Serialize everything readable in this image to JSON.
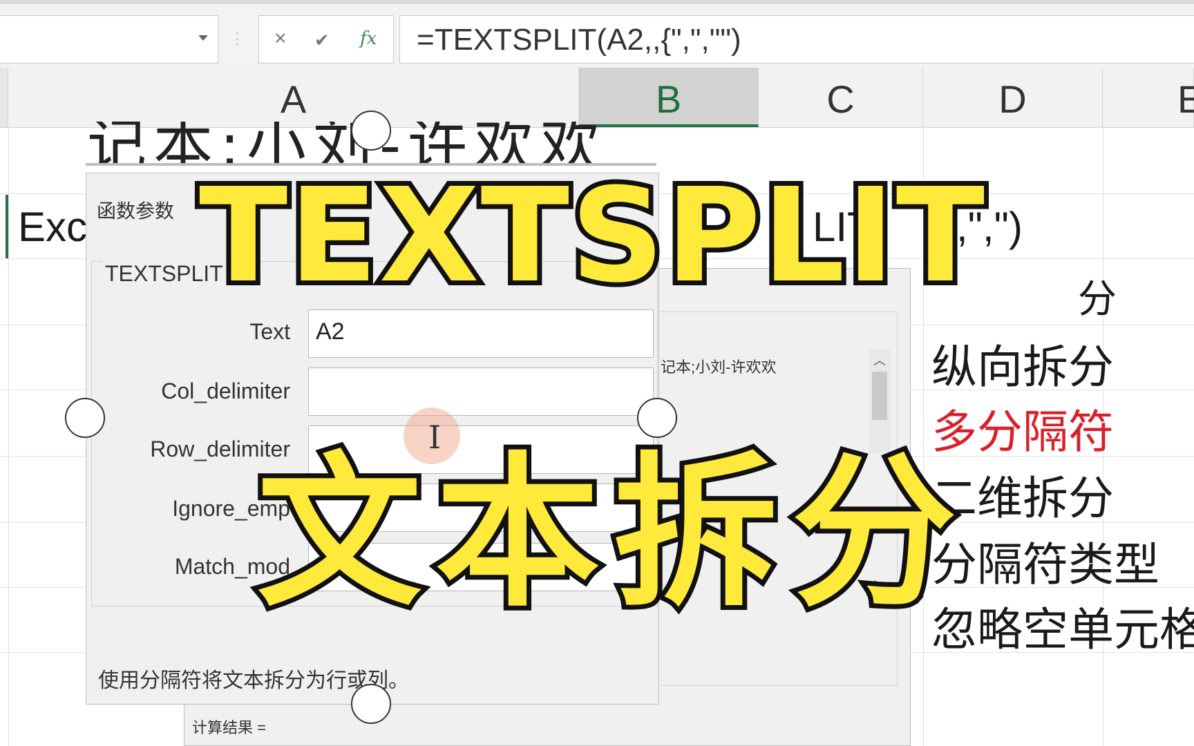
{
  "formula_bar": {
    "cancel_icon": "close-icon",
    "enter_icon": "check-icon",
    "fx_icon": "fx-icon",
    "fx_label": "fx",
    "cancel_glyph": "×",
    "enter_glyph": "✔",
    "formula": "=TEXTSPLIT(A2,,{\",\",\"\")"
  },
  "columns": [
    "A",
    "B",
    "C",
    "D",
    "E"
  ],
  "selected_column": "B",
  "cells": {
    "a2_partial": "Exc",
    "c2_partial": "LIT(",
    "e2_partial": ",\",\")",
    "d_list": [
      "纵向拆分",
      "多分隔符",
      "二维拆分",
      "分隔符类型",
      "忽略空单元格"
    ],
    "d_top_partial": "分",
    "a1_partial": "记本;小刘-许欢欢"
  },
  "dialog": {
    "title": "函数参数",
    "function_name": "TEXTSPLIT",
    "args": [
      {
        "label": "Text",
        "value": "A2"
      },
      {
        "label": "Col_delimiter",
        "value": ""
      },
      {
        "label": "Row_delimiter",
        "value": ""
      },
      {
        "label": "Ignore_emp",
        "value": ""
      },
      {
        "label": "Match_mod",
        "value": ""
      }
    ],
    "preview": "笔记本;小刘-许欢欢\"",
    "description": "使用分隔符将文本拆分为行或列。",
    "result_label": "计算结果 ="
  },
  "overlay": {
    "title": "TEXTSPLIT",
    "subtitle": "文本拆分",
    "title_color": "#ffe93a"
  },
  "colors": {
    "accent_green": "#217346",
    "red_item": "#d9202a"
  }
}
